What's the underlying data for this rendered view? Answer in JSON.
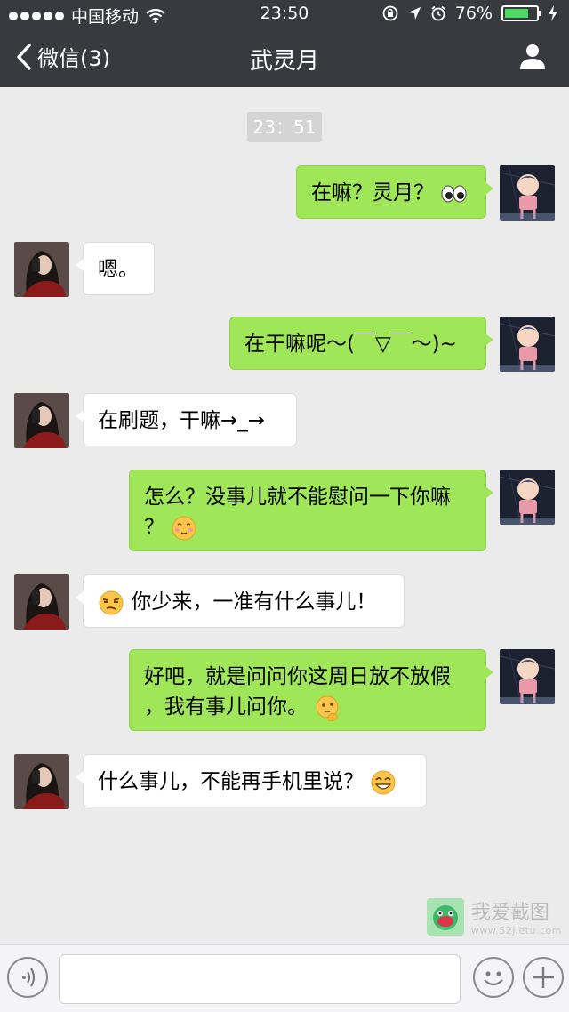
{
  "status_bar": {
    "carrier": "中国移动",
    "time": "23:50",
    "battery_percent": "76%",
    "battery_level": 0.76
  },
  "nav": {
    "back_label": "微信(3)",
    "title": "武灵月"
  },
  "chat": {
    "timestamp": "23：51",
    "messages": [
      {
        "from": "me",
        "text": "在嘛？灵月？",
        "emoji": "eyes-emoji"
      },
      {
        "from": "other",
        "text": "嗯。"
      },
      {
        "from": "me",
        "text": "在干嘛呢～(￣▽￣～)~"
      },
      {
        "from": "other",
        "text": "在刷题，干嘛→_→"
      },
      {
        "from": "me",
        "line1": "怎么？没事儿就不能慰问一下你嘛",
        "line2": "？",
        "emoji": "shy-smile-emoji"
      },
      {
        "from": "other",
        "text": "你少来，一准有什么事儿！",
        "emoji": "skeptical-emoji"
      },
      {
        "from": "me",
        "line1": "好吧，就是问问你这周日放不放假",
        "line2": "，我有事儿问你。",
        "emoji": "thinking-emoji"
      },
      {
        "from": "other",
        "text": "什么事儿，不能再手机里说？",
        "emoji": "grin-emoji"
      }
    ]
  },
  "watermark": {
    "main": "我爱截图",
    "sub": "www.52jietu.com"
  },
  "input": {
    "placeholder": ""
  },
  "colors": {
    "nav_bg": "#393a3f",
    "chat_bg": "#ebebeb",
    "my_bubble": "#9fe658",
    "their_bubble": "#ffffff"
  }
}
